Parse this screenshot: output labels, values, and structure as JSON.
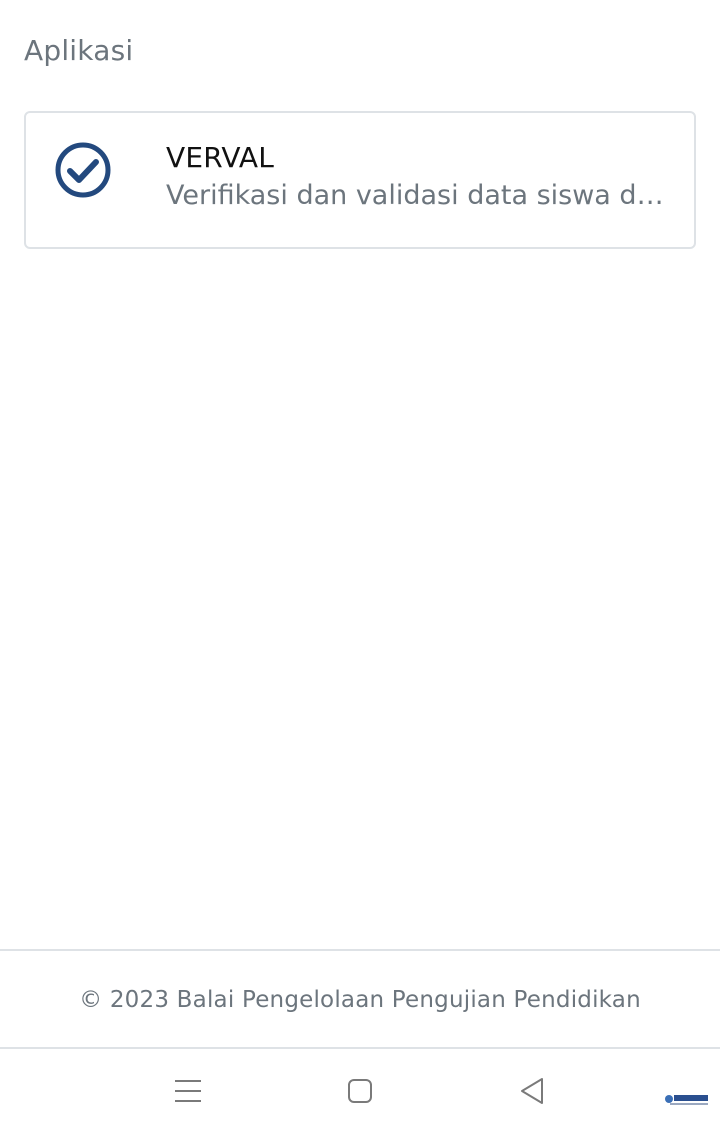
{
  "section": {
    "title": "Aplikasi"
  },
  "apps": [
    {
      "name": "VERVAL",
      "description": "Verifikasi dan validasi data siswa dan sekolah",
      "icon": "check-circle-icon"
    }
  ],
  "footer": {
    "text": "© 2023 Balai Pengelolaan Pengujian Pendidikan"
  },
  "nav": {
    "menu_icon": "menu-icon",
    "home_icon": "home-icon",
    "back_icon": "back-icon"
  },
  "colors": {
    "accent": "#23497e",
    "muted_text": "#6c757d",
    "border": "#dee2e6",
    "nav_icon": "#7a7a7a"
  }
}
